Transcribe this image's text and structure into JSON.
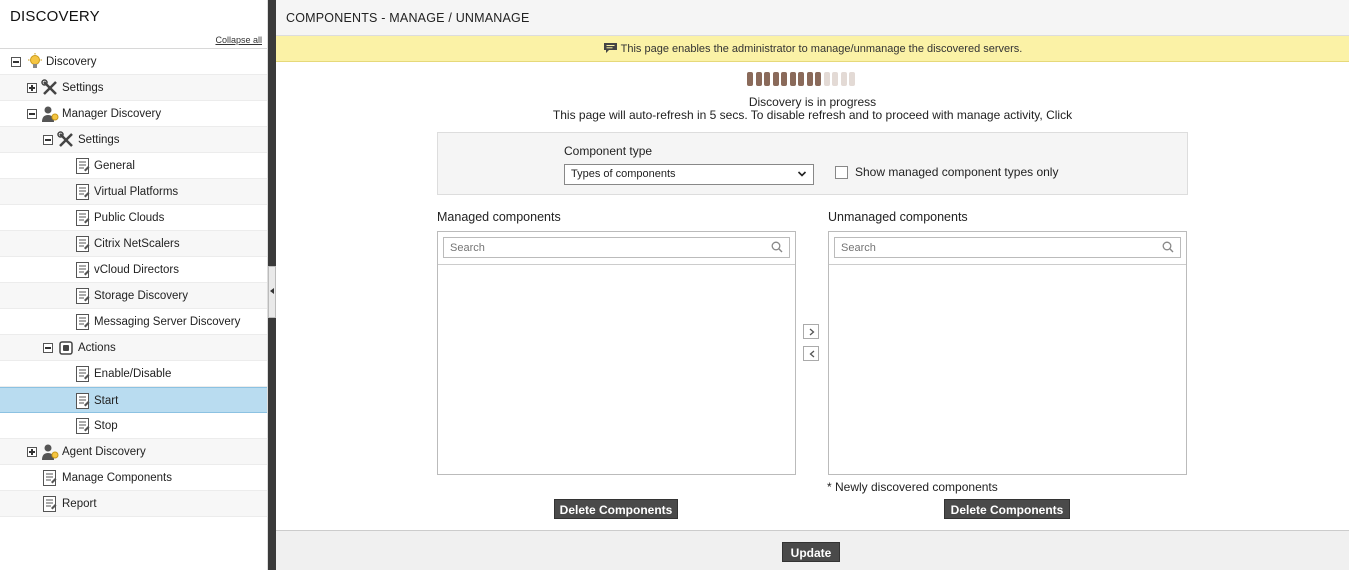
{
  "sidebar": {
    "title": "DISCOVERY",
    "collapse_all": "Collapse all",
    "tree": [
      {
        "label": "Discovery"
      },
      {
        "label": "Settings"
      },
      {
        "label": "Manager Discovery"
      },
      {
        "label": "Settings"
      },
      {
        "label": "General"
      },
      {
        "label": "Virtual Platforms"
      },
      {
        "label": "Public Clouds"
      },
      {
        "label": "Citrix NetScalers"
      },
      {
        "label": "vCloud Directors"
      },
      {
        "label": "Storage Discovery"
      },
      {
        "label": "Messaging Server Discovery"
      },
      {
        "label": "Actions"
      },
      {
        "label": "Enable/Disable"
      },
      {
        "label": "Start"
      },
      {
        "label": "Stop"
      },
      {
        "label": "Agent Discovery"
      },
      {
        "label": "Manage Components"
      },
      {
        "label": "Report"
      }
    ],
    "selected": "Start"
  },
  "main": {
    "header": "COMPONENTS - MANAGE / UNMANAGE",
    "banner": "This page enables the administrator to manage/unmanage the discovered servers.",
    "progress": {
      "filled": 9,
      "total": 13
    },
    "status_line1": "Discovery is in progress",
    "status_line2": "This page will auto-refresh in 5 secs. To disable refresh and to proceed with manage activity,",
    "status_link": "Click",
    "component_type_label": "Component type",
    "component_type_value": "Types of components",
    "show_managed_only": "Show managed component types only",
    "managed_title": "Managed components",
    "unmanaged_title": "Unmanaged components",
    "search_placeholder": "Search",
    "newly_note": "* Newly discovered components",
    "delete_label": "Delete Components",
    "update_label": "Update"
  },
  "colors": {
    "accent_selected": "#b9dcf0",
    "banner_bg": "#fbf2a6",
    "button_dark": "#4a4a4a",
    "progress_on": "#8a6a5a",
    "progress_off": "#e3dad5"
  }
}
